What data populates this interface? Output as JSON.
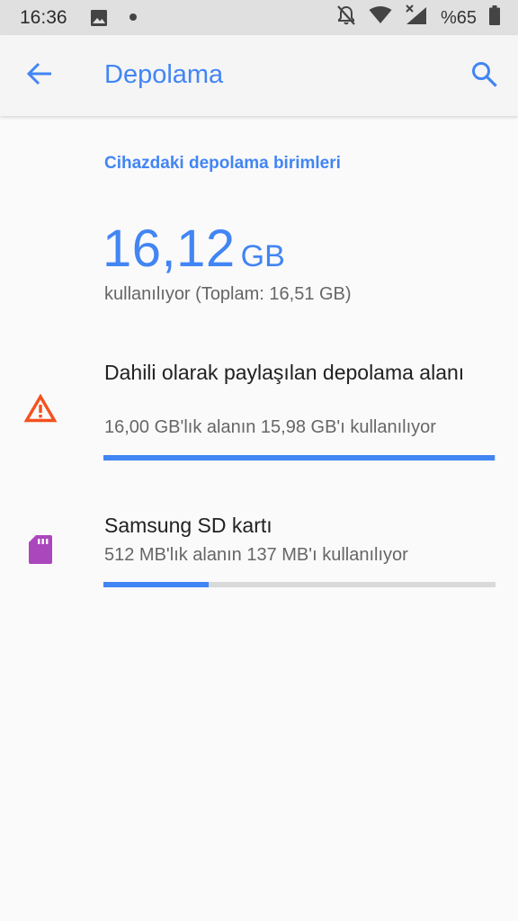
{
  "status_bar": {
    "time": "16:36",
    "battery_text": "%65",
    "icons": [
      "image-icon",
      "notification-dot-icon",
      "notifications-off-icon",
      "wifi-icon",
      "cell-signal-icon",
      "battery-icon"
    ]
  },
  "app_bar": {
    "title": "Depolama",
    "back_icon": "arrow-back-icon",
    "search_icon": "search-icon"
  },
  "storage": {
    "section_header": "Cihazdaki depolama birimleri",
    "total_used_value": "16,12",
    "total_used_unit": "GB",
    "total_subtitle": "kullanılıyor (Toplam: 16,51 GB)",
    "items": [
      {
        "title": "Dahili olarak paylaşılan depolama alanı",
        "summary": "16,00 GB'lık alanın 15,98 GB'ı kullanılıyor",
        "used_fraction": 0.9988,
        "icon": "warning-icon",
        "icon_color": "#f4511e"
      },
      {
        "title": "Samsung SD kartı",
        "summary": "512 MB'lık alanın 137 MB'ı kullanılıyor",
        "used_fraction": 0.2676,
        "icon": "sd-card-icon",
        "icon_color": "#ab47bc"
      }
    ]
  },
  "colors": {
    "accent": "#4285f4",
    "status_bar_bg": "#e0e0e0",
    "progress_track": "#d9d9d9"
  }
}
